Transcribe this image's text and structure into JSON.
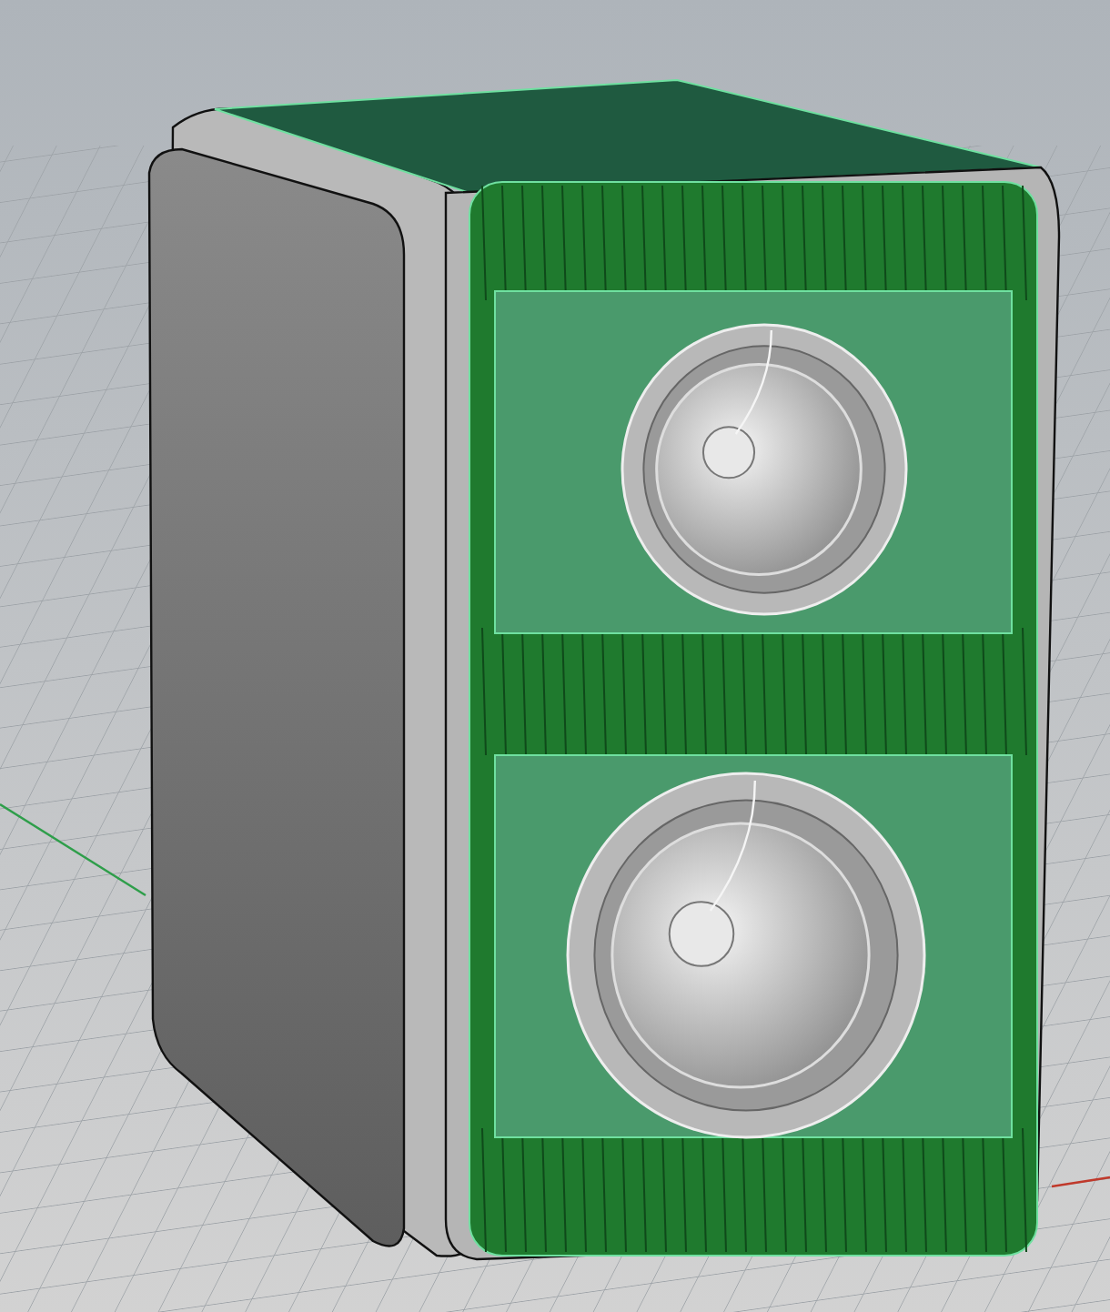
{
  "viewport": {
    "grid": true,
    "axes": true
  },
  "model": {
    "selected": true
  }
}
